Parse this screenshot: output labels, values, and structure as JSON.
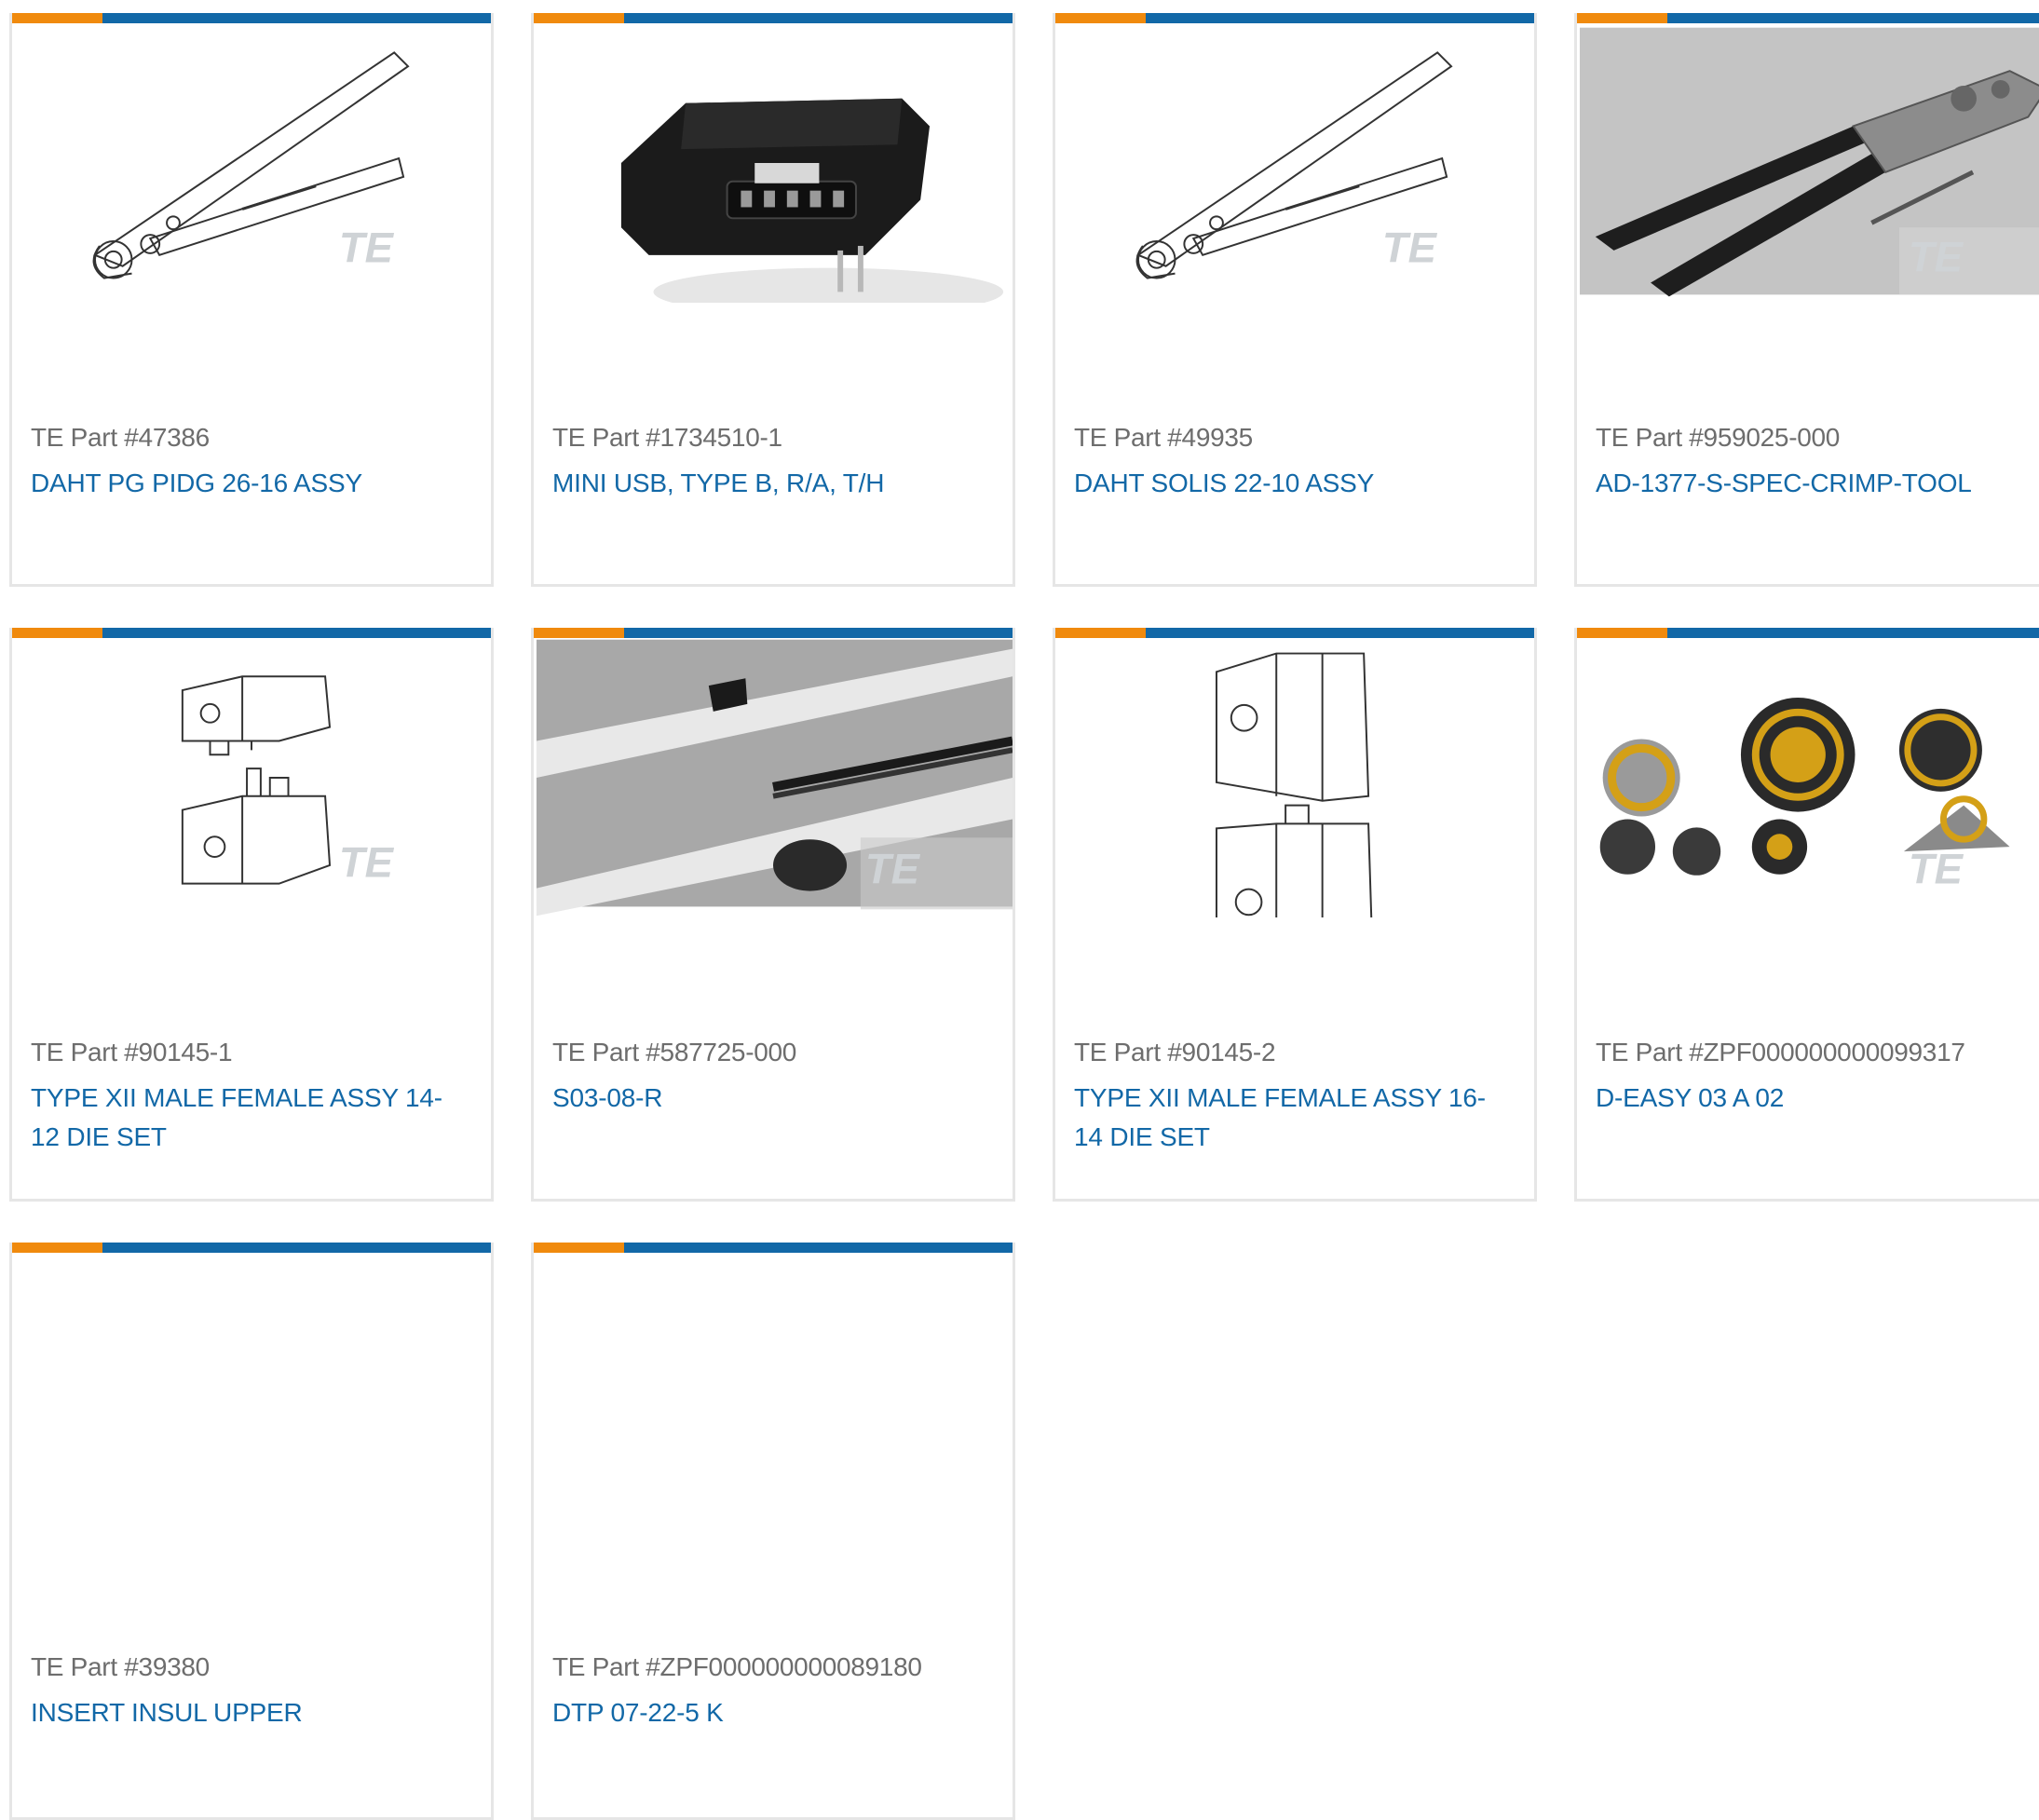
{
  "colors": {
    "accent_blue": "#1268a7",
    "accent_orange": "#f08a0d",
    "part_number_gray": "#6d6d6d",
    "card_border": "#e6e6e6"
  },
  "products": [
    {
      "part_number": "TE Part #47386",
      "description": "DAHT PG PIDG 26-16 ASSY",
      "image": "crimp-tool-drawing-icon",
      "watermark": "TE"
    },
    {
      "part_number": "TE Part #1734510-1",
      "description": "MINI USB, TYPE B, R/A, T/H",
      "image": "mini-usb-connector-icon",
      "watermark": "TE"
    },
    {
      "part_number": "TE Part #49935",
      "description": "DAHT SOLIS 22-10 ASSY",
      "image": "crimp-tool-drawing-icon",
      "watermark": "TE"
    },
    {
      "part_number": "TE Part #959025-000",
      "description": "AD-1377-S-SPEC-CRIMP-TOOL",
      "image": "crimp-tool-photo-icon",
      "watermark": "TE"
    },
    {
      "part_number": "TE Part #90145-1",
      "description": "TYPE XII MALE FEMALE ASSY 14-12 DIE SET",
      "image": "die-set-icon",
      "watermark": "TE"
    },
    {
      "part_number": "TE Part #587725-000",
      "description": "S03-08-R",
      "image": "cable-sleeve-photo-icon",
      "watermark": "TE"
    },
    {
      "part_number": "TE Part #90145-2",
      "description": "TYPE XII MALE FEMALE ASSY 16-14 DIE SET",
      "image": "die-set-icon",
      "watermark": "TE"
    },
    {
      "part_number": "TE Part #ZPF000000000099317",
      "description": "D-EASY 03 A 02",
      "image": "circular-connectors-icon",
      "watermark": "TE"
    },
    {
      "part_number": "TE Part #39380",
      "description": "INSERT INSUL UPPER",
      "image": "",
      "watermark": ""
    },
    {
      "part_number": "TE Part #ZPF000000000089180",
      "description": "DTP 07-22-5 K",
      "image": "",
      "watermark": ""
    }
  ]
}
